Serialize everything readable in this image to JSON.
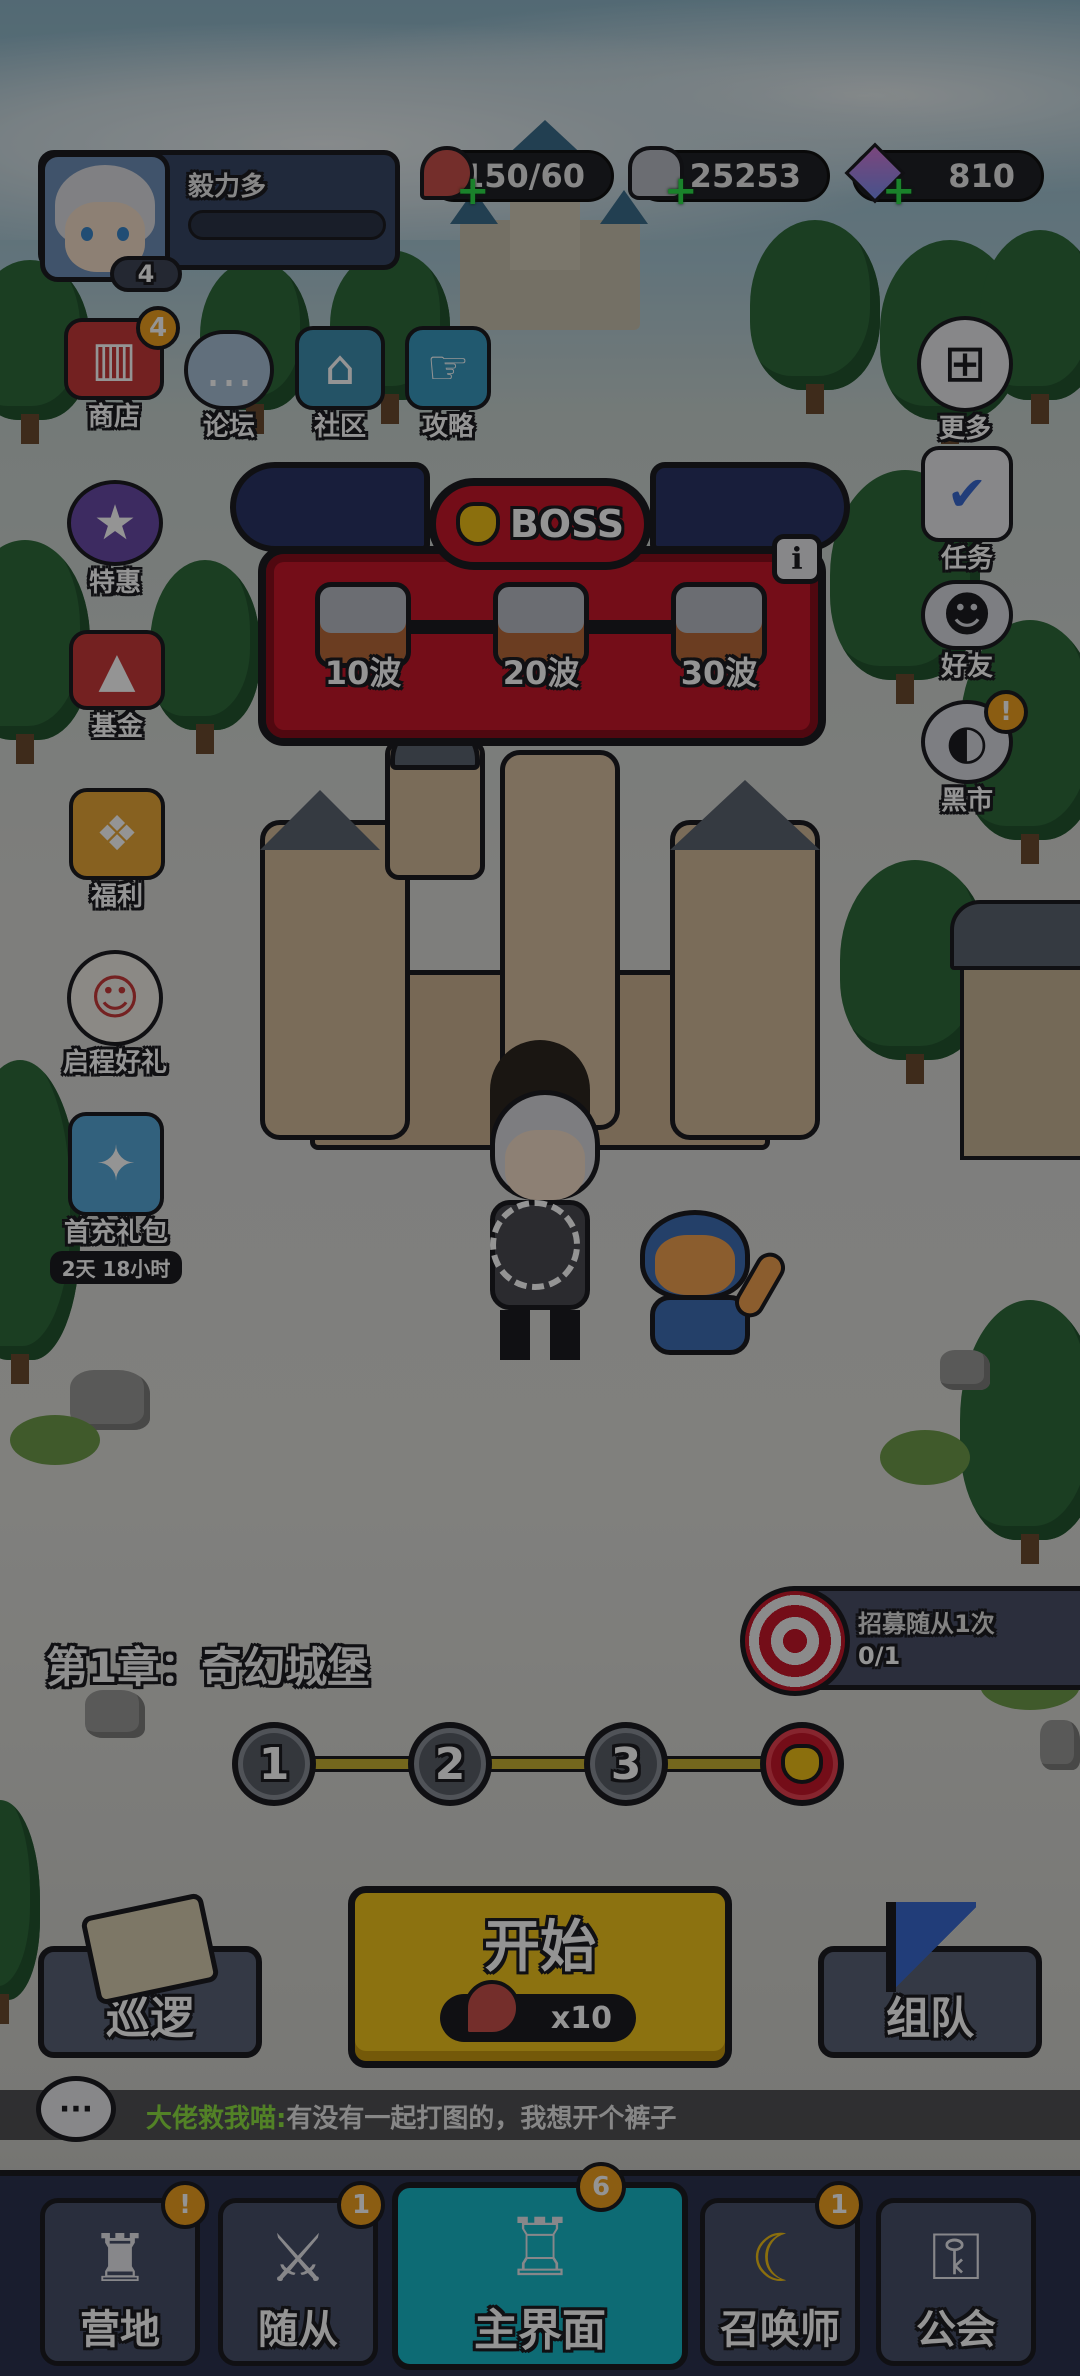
{
  "player": {
    "name": "毅力多",
    "level": "4"
  },
  "resources": [
    {
      "icon": "meat-icon",
      "value": "150/60"
    },
    {
      "icon": "silver-coin-icon",
      "value": "25253"
    },
    {
      "icon": "diamond-icon",
      "value": "810"
    }
  ],
  "top_menu": [
    {
      "label": "商店",
      "icon": "shop-icon",
      "badge": "4"
    },
    {
      "label": "论坛",
      "icon": "forum-icon"
    },
    {
      "label": "社区",
      "icon": "community-icon"
    },
    {
      "label": "攻略",
      "icon": "guide-icon"
    }
  ],
  "left_menu": [
    {
      "label": "特惠",
      "icon": "special-offer-icon"
    },
    {
      "label": "基金",
      "icon": "fund-icon"
    },
    {
      "label": "福利",
      "icon": "welfare-icon"
    },
    {
      "label": "启程好礼",
      "icon": "journey-gift-icon"
    },
    {
      "label": "首充礼包",
      "icon": "first-recharge-icon",
      "timer": "2天 18小时"
    }
  ],
  "right_menu": [
    {
      "label": "更多",
      "icon": "more-icon"
    },
    {
      "label": "任务",
      "icon": "task-icon"
    },
    {
      "label": "好友",
      "icon": "friends-icon"
    },
    {
      "label": "黑市",
      "icon": "black-market-icon",
      "badge": "!"
    }
  ],
  "boss": {
    "title": "BOSS",
    "chests": [
      "10波",
      "20波",
      "30波"
    ],
    "info": "i"
  },
  "quest": {
    "text": "招募随从1次",
    "progress": "0/1"
  },
  "chapter": {
    "title": "第1章：奇幻城堡",
    "stages": [
      "1",
      "2",
      "3"
    ]
  },
  "actions": {
    "patrol": "巡逻",
    "start": "开始",
    "cost": "x10",
    "team": "组队"
  },
  "chat": {
    "sender": "大佬救我喵:",
    "message": "有没有一起打图的，我想开个裤子"
  },
  "bottom_nav": [
    {
      "label": "营地",
      "icon": "camp-icon",
      "badge": "!"
    },
    {
      "label": "随从",
      "icon": "follower-icon",
      "badge": "1"
    },
    {
      "label": "主界面",
      "icon": "main-castle-icon",
      "badge": "6"
    },
    {
      "label": "召唤师",
      "icon": "summoner-icon",
      "badge": "1"
    },
    {
      "label": "公会",
      "icon": "guild-lock-icon"
    }
  ],
  "colors": {
    "boss_red": "#c8172a",
    "start_yellow": "#f2c41c",
    "nav_active": "#18b8c8",
    "chat_green": "#8ee043",
    "badge_orange": "#f0a020"
  }
}
